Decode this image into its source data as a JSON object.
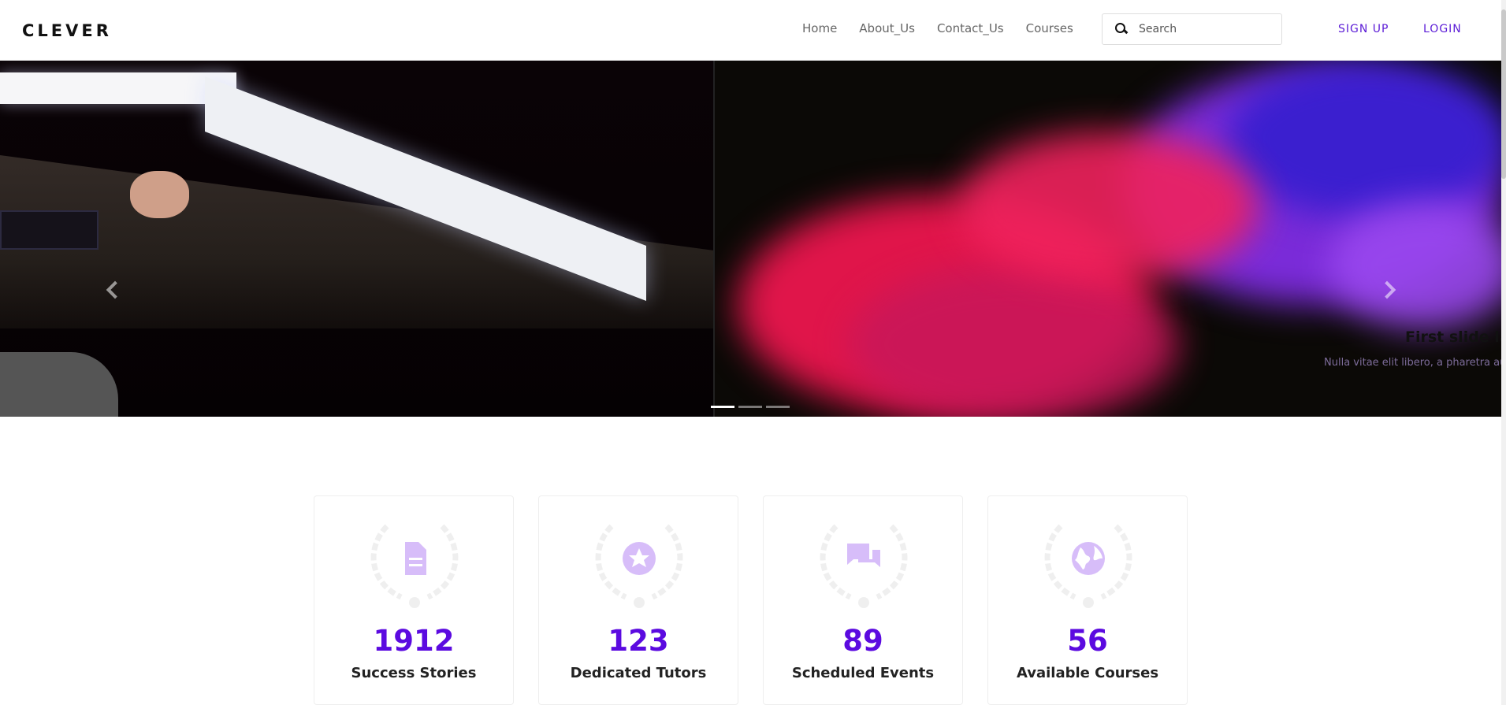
{
  "brand": {
    "name": "CLEVER"
  },
  "nav": {
    "items": [
      {
        "label": "Home"
      },
      {
        "label": "About_Us"
      },
      {
        "label": "Contact_Us"
      },
      {
        "label": "Courses"
      }
    ]
  },
  "search": {
    "placeholder": "Search"
  },
  "auth": {
    "signup_label": "SIGN UP",
    "login_label": "LOGIN"
  },
  "carousel": {
    "caption_title": "First slide la",
    "caption_text": "Nulla vitae elit libero, a pharetra au",
    "indicator_count": 3,
    "active_index": 0
  },
  "stats": [
    {
      "value": "1912",
      "label": "Success Stories",
      "icon": "document-icon"
    },
    {
      "value": "123",
      "label": "Dedicated Tutors",
      "icon": "star-icon"
    },
    {
      "value": "89",
      "label": "Scheduled Events",
      "icon": "chat-icon"
    },
    {
      "value": "56",
      "label": "Available Courses",
      "icon": "globe-icon"
    }
  ],
  "colors": {
    "accent": "#5b0ae0",
    "icon_tint": "#d7bdf9",
    "laurel": "#f1f1f1"
  }
}
